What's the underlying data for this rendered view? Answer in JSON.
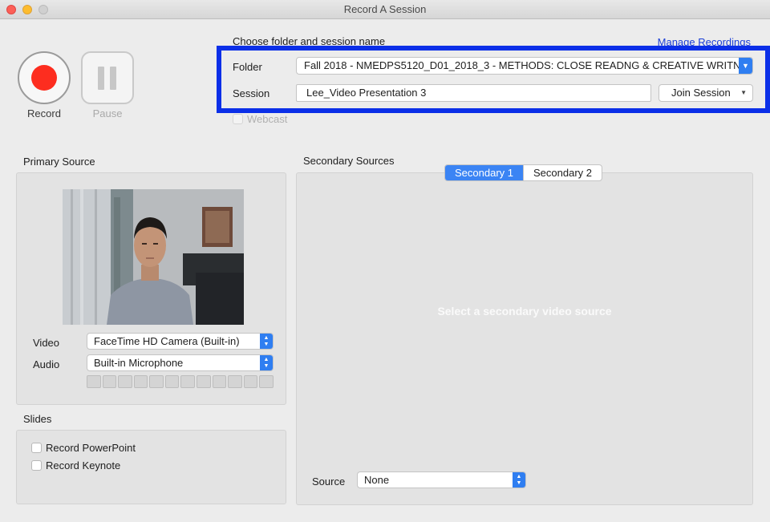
{
  "window": {
    "title": "Record A Session"
  },
  "controls": {
    "record_label": "Record",
    "pause_label": "Pause"
  },
  "session_setup": {
    "heading": "Choose folder and session name",
    "manage_link": "Manage Recordings",
    "folder_label": "Folder",
    "folder_value": "Fall 2018 - NMEDPS5120_D01_2018_3 - METHODS: CLOSE READNG & CREATIVE WRITN...",
    "session_label": "Session",
    "session_value": "Lee_Video Presentation 3",
    "join_button": "Join Session",
    "webcast_label": "Webcast"
  },
  "primary": {
    "heading": "Primary Source",
    "video_label": "Video",
    "video_value": "FaceTime HD Camera (Built-in)",
    "audio_label": "Audio",
    "audio_value": "Built-in Microphone",
    "audio_level": 0,
    "meter_segments": 12
  },
  "slides": {
    "heading": "Slides",
    "options": [
      "Record PowerPoint",
      "Record Keynote"
    ]
  },
  "secondary": {
    "heading": "Secondary Sources",
    "tabs": [
      "Secondary 1",
      "Secondary 2"
    ],
    "active_tab": "Secondary 1",
    "placeholder": "Select a secondary video source",
    "source_label": "Source",
    "source_value": "None"
  },
  "colors": {
    "record_red": "#fd2d1f",
    "highlight_blue": "#0b2fe8",
    "accent_blue": "#2f7ef1",
    "link_blue": "#1a3ed6"
  }
}
